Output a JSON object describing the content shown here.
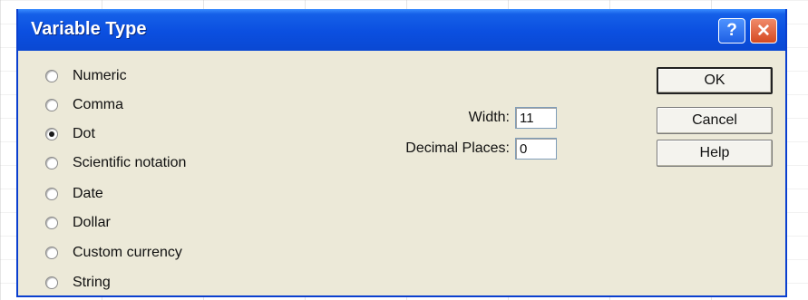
{
  "dialog": {
    "title": "Variable Type",
    "help_glyph": "?",
    "close_glyph": "✕"
  },
  "types": [
    {
      "label": "Numeric",
      "checked": false
    },
    {
      "label": "Comma",
      "checked": false
    },
    {
      "label": "Dot",
      "checked": true
    },
    {
      "label": "Scientific notation",
      "checked": false
    },
    {
      "label": "Date",
      "checked": false
    },
    {
      "label": "Dollar",
      "checked": false
    },
    {
      "label": "Custom currency",
      "checked": false
    },
    {
      "label": "String",
      "checked": false
    }
  ],
  "fields": {
    "width_label": "Width:",
    "width_value": "11",
    "decimal_label": "Decimal Places:",
    "decimal_value": "0"
  },
  "buttons": {
    "ok": "OK",
    "cancel": "Cancel",
    "help": "Help"
  },
  "colors": {
    "titlebar": "#0a48d2",
    "dialog_bg": "#ece9d8",
    "close_button": "#d54a22"
  }
}
